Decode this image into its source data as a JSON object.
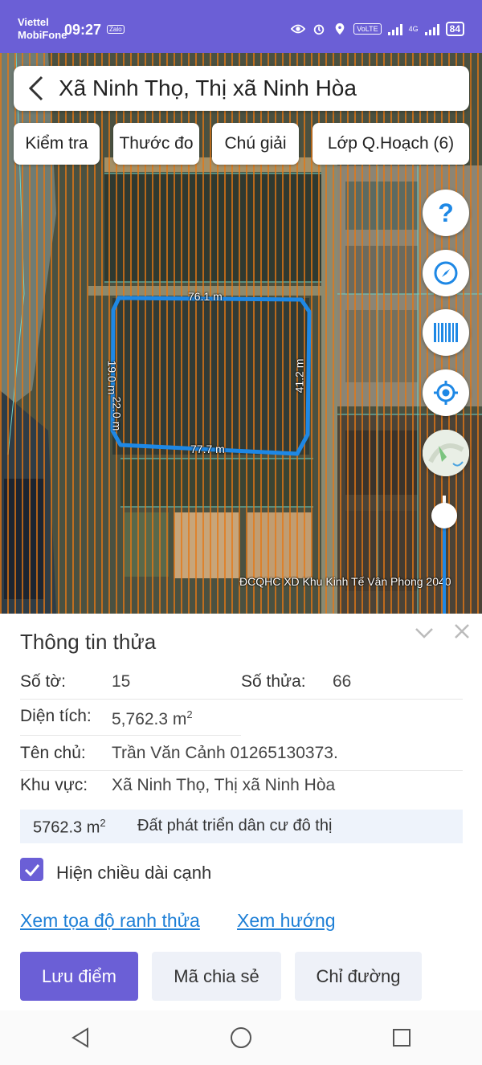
{
  "status_bar": {
    "carrier_1": "Viettel",
    "carrier_2": "MobiFone",
    "time": "09:27",
    "zalo_badge": "Zalo",
    "volte": "VoLTE",
    "network": "4G",
    "battery": "84"
  },
  "header": {
    "title": "Xã Ninh Thọ, Thị xã Ninh Hòa"
  },
  "toolbar": {
    "check": "Kiểm tra",
    "measure": "Thước đo",
    "legend": "Chú giải",
    "layers": "Lớp Q.Hoạch (6)"
  },
  "map": {
    "edge_top": "76.1 m",
    "edge_bottom": "77.7 m",
    "edge_right": "41.2 m",
    "edge_left_a": "19.0 m",
    "edge_left_b": "22.0 m",
    "caption": "ĐCQHC XD Khu Kinh Tế Vân Phong 2040",
    "help_symbol": "?",
    "zoom_slider_level": 0.17,
    "fab_icons": [
      "help-icon",
      "compass-icon",
      "barcode-icon",
      "locate-icon",
      "minimap-icon"
    ]
  },
  "panel": {
    "title": "Thông tin thửa",
    "sheet_label": "Số tờ:",
    "sheet_value": "15",
    "parcel_label": "Số thửa:",
    "parcel_value": "66",
    "area_label": "Diện tích:",
    "area_value": "5,762.3 m",
    "area_sup": "2",
    "owner_label": "Tên chủ:",
    "owner_value": "Trần Văn Cảnh 01265130373.",
    "region_label": "Khu vực:",
    "region_value": "Xã Ninh Thọ, Thị xã Ninh Hòa",
    "landuse_area": "5762.3 m",
    "landuse_area_sup": "2",
    "landuse_type": "Đất phát triển dân cư đô thị",
    "show_edges_label": "Hiện chiều dài cạnh",
    "show_edges_checked": true,
    "link_coords": "Xem tọa độ ranh thửa",
    "link_direction": "Xem hướng",
    "btn_save": "Lưu điểm",
    "btn_share": "Mã chia sẻ",
    "btn_directions": "Chỉ đường"
  },
  "colors": {
    "accent": "#6b5fd6",
    "link": "#1e7fd6",
    "parcel_outline": "#1e88e5",
    "planning_stripes": "#e67814"
  }
}
